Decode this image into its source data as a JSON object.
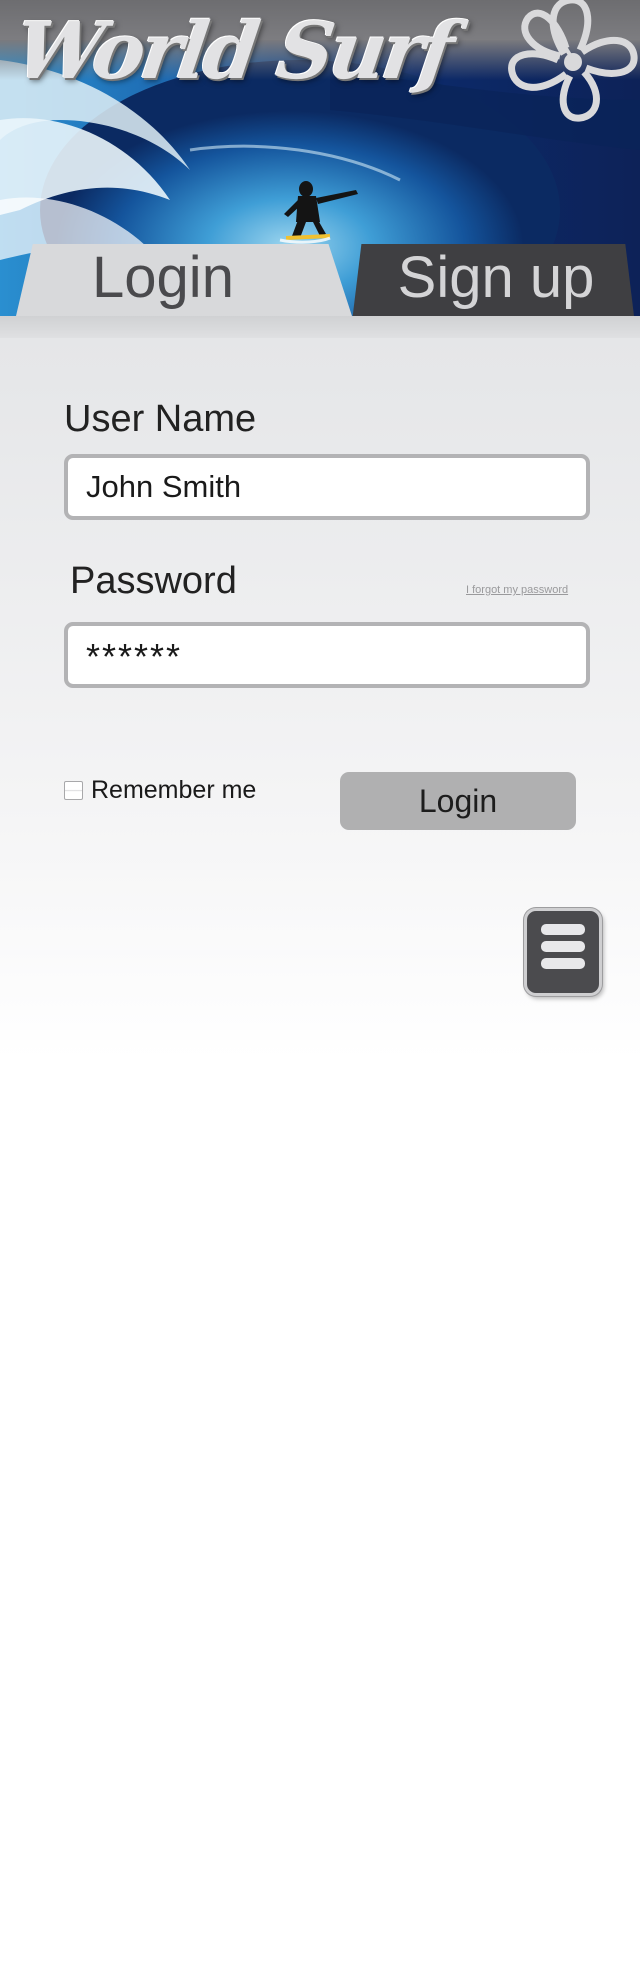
{
  "header": {
    "logo_text": "World Surf"
  },
  "tabs": {
    "login_label": "Login",
    "signup_label": "Sign up",
    "active": "login"
  },
  "form": {
    "username_label": "User Name",
    "username_value": "John Smith",
    "password_label": "Password",
    "password_value": "******",
    "forgot_label": "I forgot my password",
    "remember_label": "Remember me",
    "remember_checked": false,
    "submit_label": "Login"
  },
  "icons": {
    "hibiscus": "hibiscus-flower-icon",
    "menu": "hamburger-menu-icon",
    "checkbox": "checkbox-unchecked"
  },
  "colors": {
    "active_tab": "#d8d9db",
    "inactive_tab": "#3f3f42",
    "button": "#b0b0b1",
    "menu_button": "#4b4b4e"
  }
}
